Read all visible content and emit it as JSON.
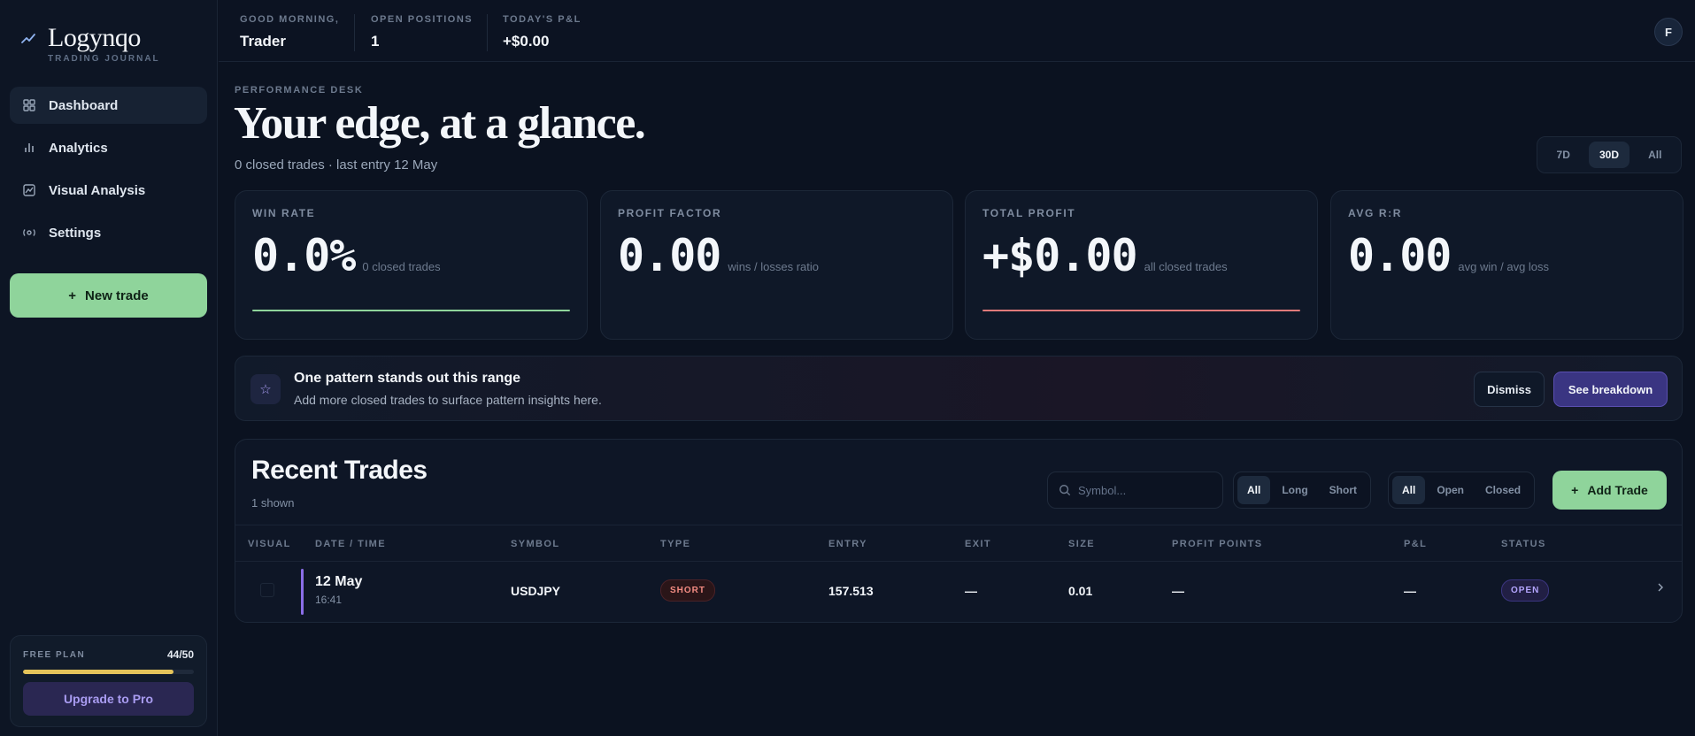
{
  "brand": {
    "name": "Logynqo",
    "tagline": "TRADING JOURNAL"
  },
  "sidebar": {
    "items": [
      {
        "label": "Dashboard",
        "icon": "grid-icon",
        "active": true
      },
      {
        "label": "Analytics",
        "icon": "bar-chart-icon"
      },
      {
        "label": "Visual Analysis",
        "icon": "chart-frame-icon"
      },
      {
        "label": "Settings",
        "icon": "gear-icon"
      }
    ],
    "new_trade_label": "New trade",
    "plan": {
      "label": "FREE PLAN",
      "count": "44/50",
      "usage_fraction": 0.88,
      "upgrade_label": "Upgrade to Pro"
    }
  },
  "topbar": {
    "greeting_label": "GOOD MORNING,",
    "greeting_value": "Trader",
    "positions_label": "OPEN POSITIONS",
    "positions_value": "1",
    "pnl_label": "TODAY'S P&L",
    "pnl_value": "+$0.00",
    "avatar_initial": "F"
  },
  "header": {
    "eyebrow": "PERFORMANCE DESK",
    "title": "Your edge, at a glance.",
    "subtitle": "0 closed trades · last entry 12 May",
    "ranges": [
      "7D",
      "30D",
      "All"
    ],
    "active_range": "30D"
  },
  "metrics": [
    {
      "label": "WIN RATE",
      "value": "0.0%",
      "sub": "0 closed trades",
      "line": "#8fd49b"
    },
    {
      "label": "PROFIT FACTOR",
      "value": "0.00",
      "sub": "wins / losses ratio",
      "line": ""
    },
    {
      "label": "TOTAL PROFIT",
      "value": "+$0.00",
      "sub": "all closed trades",
      "line": "#e07a7a"
    },
    {
      "label": "AVG R:R",
      "value": "0.00",
      "sub": "avg win / avg loss",
      "line": ""
    }
  ],
  "insight": {
    "title": "One pattern stands out this range",
    "text": "Add more closed trades to surface pattern insights here.",
    "dismiss_label": "Dismiss",
    "breakdown_label": "See breakdown"
  },
  "trades": {
    "title": "Recent Trades",
    "count": "1 shown",
    "search_placeholder": "Symbol...",
    "direction_filters": [
      "All",
      "Long",
      "Short"
    ],
    "status_filters": [
      "All",
      "Open",
      "Closed"
    ],
    "add_label": "Add Trade",
    "columns": [
      "VISUAL",
      "DATE / TIME",
      "SYMBOL",
      "TYPE",
      "ENTRY",
      "EXIT",
      "SIZE",
      "PROFIT POINTS",
      "P&L",
      "STATUS"
    ],
    "rows": [
      {
        "date": "12 May",
        "time": "16:41",
        "symbol": "USDJPY",
        "type": "SHORT",
        "entry": "157.513",
        "exit": "—",
        "size": "0.01",
        "profit_points": "—",
        "pnl": "—",
        "status": "OPEN"
      }
    ]
  },
  "colors": {
    "accent_green": "#8fd49b",
    "accent_purple": "#3a3582",
    "loss_red": "#e07a7a",
    "plan_yellow": "#e5c45a"
  }
}
